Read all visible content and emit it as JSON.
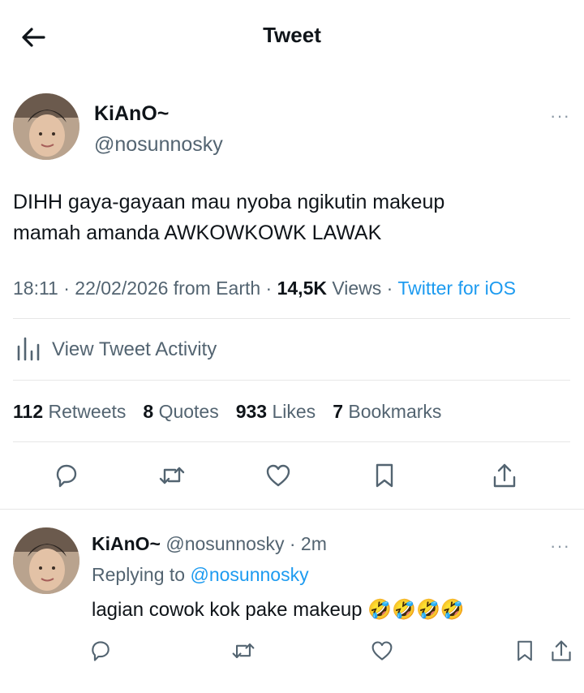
{
  "header": {
    "title": "Tweet"
  },
  "tweet": {
    "display_name": "KiAnO~",
    "handle": "@nosunnosky",
    "text_line1": "DIHH gaya-gayaan mau nyoba ngikutin makeup",
    "text_line2": "mamah amanda AWKOWKOWK LAWAK",
    "time": "18:11 · 22/02/2026 from Earth · ",
    "views_count": "14,5K",
    "views_label": " Views · ",
    "client": "Twitter for iOS",
    "activity_label": "View Tweet Activity",
    "stats": {
      "retweets_count": "112",
      "retweets_label": "Retweets",
      "quotes_count": "8",
      "quotes_label": "Quotes",
      "likes_count": "933",
      "likes_label": "Likes",
      "bookmarks_count": "7",
      "bookmarks_label": "Bookmarks"
    },
    "more_label": "···"
  },
  "reply": {
    "display_name": "KiAnO~",
    "handle_time": "@nosunnosky · 2m",
    "replying_prefix": "Replying to ",
    "replying_to": "@nosunnosky",
    "text": "lagian cowok kok pake makeup 🤣🤣🤣🤣",
    "more_label": "···"
  },
  "colors": {
    "accent": "#1d9bf0",
    "text": "#0f1419",
    "secondary": "#536471",
    "divider": "#e7e7e7"
  },
  "icons": [
    "back-arrow-icon",
    "avatar",
    "more-icon",
    "activity-bars-icon",
    "reply-icon",
    "retweet-icon",
    "like-icon",
    "bookmark-icon",
    "share-icon"
  ]
}
